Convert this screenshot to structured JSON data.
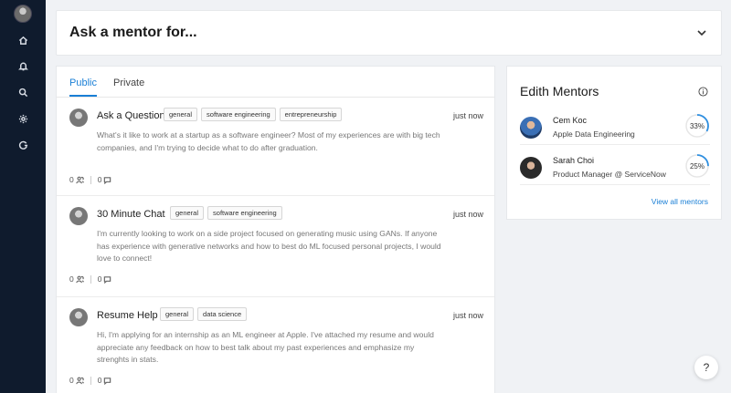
{
  "header": {
    "title": "Ask a mentor for..."
  },
  "sidebar": {
    "icons": [
      "home-icon",
      "bell-icon",
      "search-icon",
      "gear-icon",
      "logout-icon"
    ]
  },
  "tabs": {
    "public": "Public",
    "private": "Private"
  },
  "posts": [
    {
      "title": "Ask a Question",
      "tags": [
        "general",
        "software engineering",
        "entrepreneurship"
      ],
      "time": "just now",
      "body": "What's it like to work at a startup as a software engineer? Most of my experiences are with big tech companies, and I'm trying to decide what to do after graduation.",
      "upvotes": "0",
      "comments": "0"
    },
    {
      "title": "30 Minute Chat",
      "tags": [
        "general",
        "software engineering"
      ],
      "time": "just now",
      "body": "I'm currently looking to work on a side project focused on generating music using GANs. If anyone has experience with generative networks and how to best do ML focused personal projects, I would love to connect!",
      "upvotes": "0",
      "comments": "0"
    },
    {
      "title": "Resume Help",
      "tags": [
        "general",
        "data science"
      ],
      "time": "just now",
      "body": "Hi, I'm applying for an internship as an ML engineer at Apple. I've attached my resume and would appreciate any feedback on how to best talk about my past experiences and emphasize my strenghts in stats.",
      "upvotes": "0",
      "comments": "0"
    }
  ],
  "mentors": {
    "title": "Edith Mentors",
    "list": [
      {
        "name": "Cem Koc",
        "role": "Apple Data Engineering",
        "match": "33%",
        "match_value": 33
      },
      {
        "name": "Sarah Choi",
        "role": "Product Manager @ ServiceNow",
        "match": "25%",
        "match_value": 25
      }
    ],
    "view_all": "View all mentors"
  },
  "help": {
    "label": "?"
  },
  "colors": {
    "accent": "#1a7fd6",
    "sidebar": "#0f1b2d"
  }
}
